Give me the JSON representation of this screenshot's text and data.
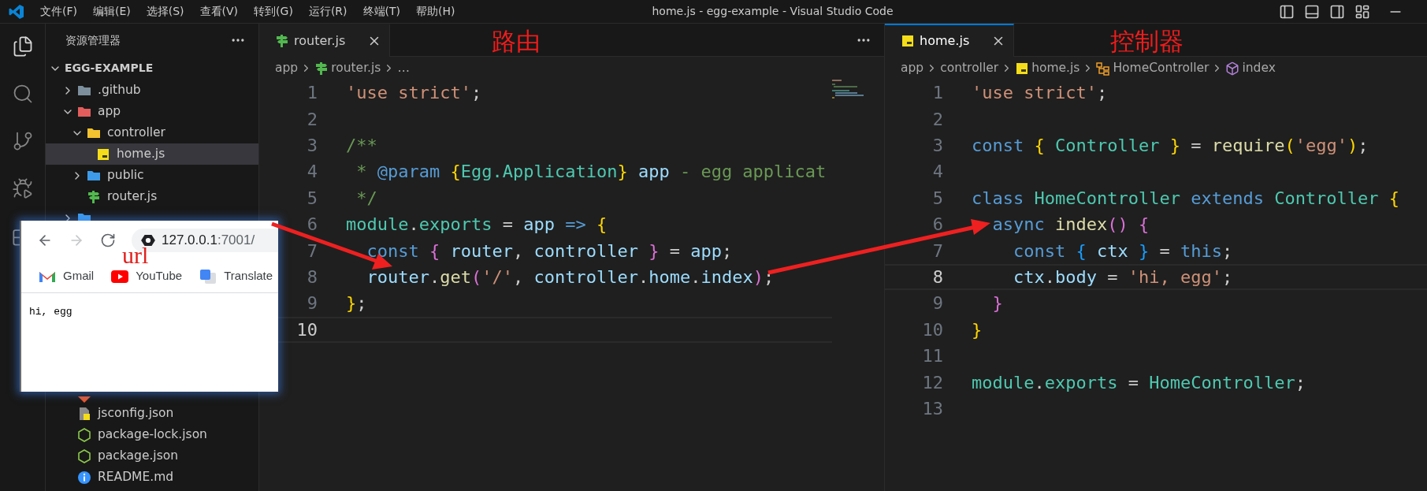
{
  "title_bar": {
    "menus": [
      "文件(F)",
      "编辑(E)",
      "选择(S)",
      "查看(V)",
      "转到(G)",
      "运行(R)",
      "终端(T)",
      "帮助(H)"
    ],
    "title": "home.js - egg-example - Visual Studio Code"
  },
  "activity_bar": [
    {
      "kind": "explorer",
      "selected": true
    },
    {
      "kind": "search",
      "selected": false
    },
    {
      "kind": "scm",
      "selected": false
    },
    {
      "kind": "debug",
      "selected": false
    },
    {
      "kind": "extensions",
      "selected": false
    }
  ],
  "explorer": {
    "title": "资源管理器",
    "root": {
      "label": "EGG-EXAMPLE",
      "expanded": true
    },
    "items": [
      {
        "label": ".github",
        "kind": "folder",
        "color": "#7d8f9c",
        "expanded": false,
        "selected": false
      },
      {
        "label": "app",
        "kind": "folder",
        "color": "#e35d5d",
        "expanded": true,
        "selected": false,
        "children": [
          {
            "label": "controller",
            "kind": "folder",
            "color": "#f2c230",
            "expanded": true,
            "selected": false,
            "children": [
              {
                "label": "home.js",
                "kind": "js",
                "selected": true
              }
            ]
          },
          {
            "label": "public",
            "kind": "folder",
            "color": "#3d9be9",
            "expanded": false,
            "selected": false
          },
          {
            "label": "router.js",
            "kind": "router",
            "selected": false
          }
        ]
      },
      {
        "kind": "folder",
        "color": "#3d9be9",
        "expanded": false,
        "selected": false
      }
    ],
    "items_below_browser": [
      {
        "kind": "git",
        "selected": false
      },
      {
        "label": "jsconfig.json",
        "kind": "jsconfig",
        "selected": false
      },
      {
        "label": "package-lock.json",
        "kind": "node",
        "selected": false
      },
      {
        "label": "package.json",
        "kind": "node",
        "selected": false
      },
      {
        "label": "README.md",
        "kind": "info",
        "selected": false
      }
    ]
  },
  "editors": [
    {
      "focused": false,
      "show_actions": true,
      "minimap": true,
      "annotation": "路由",
      "tab": {
        "label": "router.js",
        "kind": "router"
      },
      "breadcrumbs": [
        {
          "label": "app"
        },
        {
          "label": "router.js",
          "kind": "router"
        },
        {
          "label": "…"
        }
      ],
      "lines": [
        {
          "number": "1",
          "current": false,
          "tokens": [
            {
              "kind": "str",
              "text": "'use strict'"
            },
            {
              "kind": "plain",
              "text": ";"
            }
          ]
        },
        {
          "number": "2",
          "current": false
        },
        {
          "number": "3",
          "current": false,
          "tokens": [
            {
              "kind": "comment",
              "text": "/**"
            }
          ]
        },
        {
          "number": "4",
          "current": false,
          "tokens": [
            {
              "kind": "comment",
              "text": " * "
            },
            {
              "kind": "kw",
              "text": "@param"
            },
            {
              "kind": "b1",
              "text": " {"
            },
            {
              "kind": "type",
              "text": "Egg.Application"
            },
            {
              "kind": "b1",
              "text": "}"
            },
            {
              "kind": "var",
              "text": " app"
            },
            {
              "kind": "comment",
              "text": " - egg applicat"
            }
          ]
        },
        {
          "number": "5",
          "current": false,
          "tokens": [
            {
              "kind": "comment",
              "text": " */"
            }
          ]
        },
        {
          "number": "6",
          "current": false,
          "tokens": [
            {
              "kind": "type",
              "text": "module"
            },
            {
              "kind": "plain",
              "text": "."
            },
            {
              "kind": "type",
              "text": "exports"
            },
            {
              "kind": "plain",
              "text": " = "
            },
            {
              "kind": "var",
              "text": "app"
            },
            {
              "kind": "kw",
              "text": " => "
            },
            {
              "kind": "b1",
              "text": "{"
            }
          ]
        },
        {
          "number": "7",
          "current": false,
          "tokens": [
            {
              "kind": "kw",
              "text": "  const"
            },
            {
              "kind": "b2",
              "text": " {"
            },
            {
              "kind": "var",
              "text": " router"
            },
            {
              "kind": "plain",
              "text": ","
            },
            {
              "kind": "var",
              "text": " controller "
            },
            {
              "kind": "b2",
              "text": "}"
            },
            {
              "kind": "plain",
              "text": " = "
            },
            {
              "kind": "var",
              "text": "app"
            },
            {
              "kind": "plain",
              "text": ";"
            }
          ]
        },
        {
          "number": "8",
          "current": false,
          "tokens": [
            {
              "kind": "var",
              "text": "  router"
            },
            {
              "kind": "plain",
              "text": "."
            },
            {
              "kind": "fn",
              "text": "get"
            },
            {
              "kind": "b2",
              "text": "("
            },
            {
              "kind": "str",
              "text": "'/'"
            },
            {
              "kind": "plain",
              "text": ", "
            },
            {
              "kind": "var",
              "text": "controller"
            },
            {
              "kind": "plain",
              "text": "."
            },
            {
              "kind": "var",
              "text": "home"
            },
            {
              "kind": "plain",
              "text": "."
            },
            {
              "kind": "var",
              "text": "index"
            },
            {
              "kind": "b2",
              "text": ")"
            },
            {
              "kind": "plain",
              "text": ";"
            }
          ]
        },
        {
          "number": "9",
          "current": false,
          "tokens": [
            {
              "kind": "b1",
              "text": "}"
            },
            {
              "kind": "plain",
              "text": ";"
            }
          ]
        },
        {
          "number": "10",
          "current": true
        }
      ]
    },
    {
      "focused": true,
      "annotation": "控制器",
      "tab": {
        "label": "home.js",
        "kind": "js"
      },
      "breadcrumbs": [
        {
          "label": "app"
        },
        {
          "label": "controller"
        },
        {
          "label": "home.js",
          "kind": "js"
        },
        {
          "label": "HomeController",
          "kind": "class"
        },
        {
          "label": "index",
          "kind": "method"
        }
      ],
      "lines": [
        {
          "number": "1",
          "current": false,
          "tokens": [
            {
              "kind": "str",
              "text": "'use strict'"
            },
            {
              "kind": "plain",
              "text": ";"
            }
          ]
        },
        {
          "number": "2",
          "current": false
        },
        {
          "number": "3",
          "current": false,
          "tokens": [
            {
              "kind": "kw",
              "text": "const"
            },
            {
              "kind": "b1",
              "text": " {"
            },
            {
              "kind": "type",
              "text": " Controller"
            },
            {
              "kind": "b1",
              "text": " }"
            },
            {
              "kind": "plain",
              "text": " = "
            },
            {
              "kind": "fn",
              "text": "require"
            },
            {
              "kind": "b1",
              "text": "("
            },
            {
              "kind": "str",
              "text": "'egg'"
            },
            {
              "kind": "b1",
              "text": ")"
            },
            {
              "kind": "plain",
              "text": ";"
            }
          ]
        },
        {
          "number": "4",
          "current": false
        },
        {
          "number": "5",
          "current": false,
          "tokens": [
            {
              "kind": "kw",
              "text": "class"
            },
            {
              "kind": "type",
              "text": " HomeController"
            },
            {
              "kind": "kw",
              "text": " extends"
            },
            {
              "kind": "type",
              "text": " Controller"
            },
            {
              "kind": "b1",
              "text": " {"
            }
          ]
        },
        {
          "number": "6",
          "current": false,
          "tokens": [
            {
              "kind": "kw",
              "text": "  async"
            },
            {
              "kind": "fn",
              "text": " index"
            },
            {
              "kind": "b2",
              "text": "()"
            },
            {
              "kind": "b2",
              "text": " {"
            }
          ]
        },
        {
          "number": "7",
          "current": false,
          "tokens": [
            {
              "kind": "kw",
              "text": "    const"
            },
            {
              "kind": "b3",
              "text": " {"
            },
            {
              "kind": "var",
              "text": " ctx "
            },
            {
              "kind": "b3",
              "text": "}"
            },
            {
              "kind": "plain",
              "text": " = "
            },
            {
              "kind": "kw",
              "text": "this"
            },
            {
              "kind": "plain",
              "text": ";"
            }
          ]
        },
        {
          "number": "8",
          "current": true,
          "tokens": [
            {
              "kind": "var",
              "text": "    ctx"
            },
            {
              "kind": "plain",
              "text": "."
            },
            {
              "kind": "var",
              "text": "body"
            },
            {
              "kind": "plain",
              "text": " = "
            },
            {
              "kind": "str",
              "text": "'hi, egg'"
            },
            {
              "kind": "plain",
              "text": ";"
            }
          ]
        },
        {
          "number": "9",
          "current": false,
          "tokens": [
            {
              "kind": "b2",
              "text": "  }"
            }
          ]
        },
        {
          "number": "10",
          "current": false,
          "tokens": [
            {
              "kind": "b1",
              "text": "}"
            }
          ]
        },
        {
          "number": "11",
          "current": false
        },
        {
          "number": "12",
          "current": false,
          "tokens": [
            {
              "kind": "type",
              "text": "module"
            },
            {
              "kind": "plain",
              "text": "."
            },
            {
              "kind": "type",
              "text": "exports"
            },
            {
              "kind": "plain",
              "text": " = "
            },
            {
              "kind": "type",
              "text": "HomeController"
            },
            {
              "kind": "plain",
              "text": ";"
            }
          ]
        },
        {
          "number": "13",
          "current": false
        }
      ]
    }
  ],
  "browser_popup": {
    "host": "127.0.0.1",
    "path": ":7001/",
    "forward_disabled": true,
    "annotation": "url",
    "bookmarks": [
      {
        "label": "Gmail",
        "kind": "gmail"
      },
      {
        "label": "YouTube",
        "kind": "youtube"
      },
      {
        "label": "Translate",
        "kind": "translate"
      }
    ],
    "page_text": "hi, egg"
  }
}
